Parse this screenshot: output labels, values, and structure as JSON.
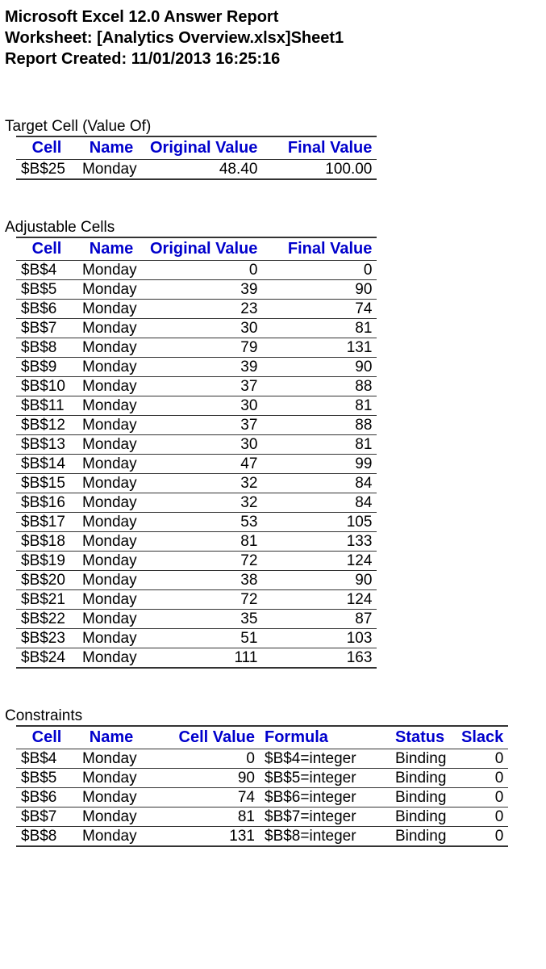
{
  "header": {
    "line1": "Microsoft Excel 12.0 Answer Report",
    "line2": "Worksheet: [Analytics Overview.xlsx]Sheet1",
    "line3": "Report Created: 11/01/2013 16:25:16"
  },
  "targetSection": {
    "title": "Target Cell (Value Of)",
    "columns": {
      "cell": "Cell",
      "name": "Name",
      "orig": "Original Value",
      "final": "Final Value"
    },
    "rows": [
      {
        "cell": "$B$25",
        "name": "Monday",
        "orig": "48.40",
        "final": "100.00"
      }
    ]
  },
  "adjustableSection": {
    "title": "Adjustable Cells",
    "columns": {
      "cell": "Cell",
      "name": "Name",
      "orig": "Original Value",
      "final": "Final Value"
    },
    "rows": [
      {
        "cell": "$B$4",
        "name": "Monday",
        "orig": "0",
        "final": "0"
      },
      {
        "cell": "$B$5",
        "name": "Monday",
        "orig": "39",
        "final": "90"
      },
      {
        "cell": "$B$6",
        "name": "Monday",
        "orig": "23",
        "final": "74"
      },
      {
        "cell": "$B$7",
        "name": "Monday",
        "orig": "30",
        "final": "81"
      },
      {
        "cell": "$B$8",
        "name": "Monday",
        "orig": "79",
        "final": "131"
      },
      {
        "cell": "$B$9",
        "name": "Monday",
        "orig": "39",
        "final": "90"
      },
      {
        "cell": "$B$10",
        "name": "Monday",
        "orig": "37",
        "final": "88"
      },
      {
        "cell": "$B$11",
        "name": "Monday",
        "orig": "30",
        "final": "81"
      },
      {
        "cell": "$B$12",
        "name": "Monday",
        "orig": "37",
        "final": "88"
      },
      {
        "cell": "$B$13",
        "name": "Monday",
        "orig": "30",
        "final": "81"
      },
      {
        "cell": "$B$14",
        "name": "Monday",
        "orig": "47",
        "final": "99"
      },
      {
        "cell": "$B$15",
        "name": "Monday",
        "orig": "32",
        "final": "84"
      },
      {
        "cell": "$B$16",
        "name": "Monday",
        "orig": "32",
        "final": "84"
      },
      {
        "cell": "$B$17",
        "name": "Monday",
        "orig": "53",
        "final": "105"
      },
      {
        "cell": "$B$18",
        "name": "Monday",
        "orig": "81",
        "final": "133"
      },
      {
        "cell": "$B$19",
        "name": "Monday",
        "orig": "72",
        "final": "124"
      },
      {
        "cell": "$B$20",
        "name": "Monday",
        "orig": "38",
        "final": "90"
      },
      {
        "cell": "$B$21",
        "name": "Monday",
        "orig": "72",
        "final": "124"
      },
      {
        "cell": "$B$22",
        "name": "Monday",
        "orig": "35",
        "final": "87"
      },
      {
        "cell": "$B$23",
        "name": "Monday",
        "orig": "51",
        "final": "103"
      },
      {
        "cell": "$B$24",
        "name": "Monday",
        "orig": "111",
        "final": "163"
      }
    ]
  },
  "constraintsSection": {
    "title": "Constraints",
    "columns": {
      "cell": "Cell",
      "name": "Name",
      "value": "Cell Value",
      "formula": "Formula",
      "status": "Status",
      "slack": "Slack"
    },
    "rows": [
      {
        "cell": "$B$4",
        "name": "Monday",
        "value": "0",
        "formula": "$B$4=integer",
        "status": "Binding",
        "slack": "0"
      },
      {
        "cell": "$B$5",
        "name": "Monday",
        "value": "90",
        "formula": "$B$5=integer",
        "status": "Binding",
        "slack": "0"
      },
      {
        "cell": "$B$6",
        "name": "Monday",
        "value": "74",
        "formula": "$B$6=integer",
        "status": "Binding",
        "slack": "0"
      },
      {
        "cell": "$B$7",
        "name": "Monday",
        "value": "81",
        "formula": "$B$7=integer",
        "status": "Binding",
        "slack": "0"
      },
      {
        "cell": "$B$8",
        "name": "Monday",
        "value": "131",
        "formula": "$B$8=integer",
        "status": "Binding",
        "slack": "0"
      }
    ]
  }
}
